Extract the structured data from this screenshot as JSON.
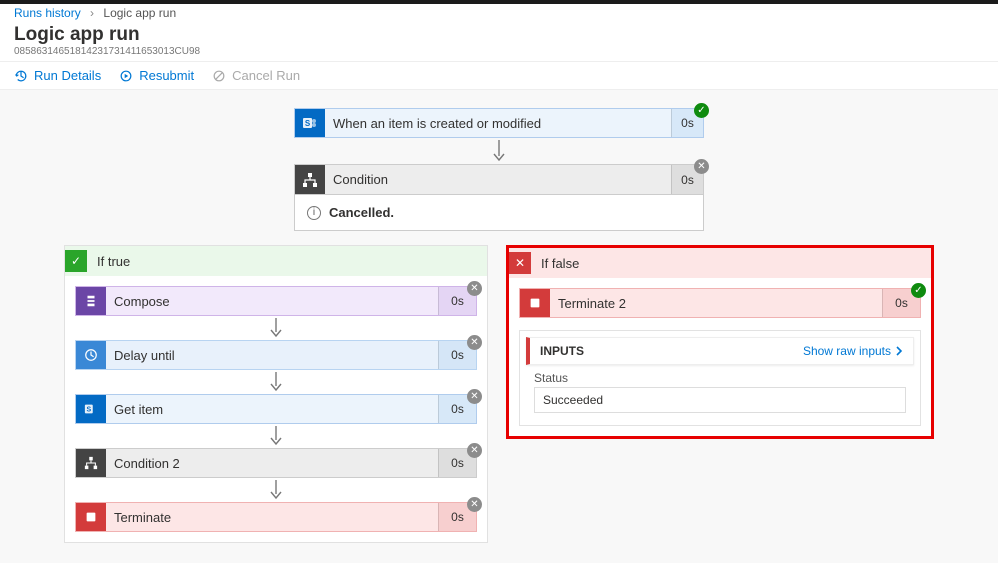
{
  "breadcrumb": {
    "root": "Runs history",
    "current": "Logic app run"
  },
  "header": {
    "title": "Logic app run",
    "run_id": "08586314651814231731411653013CU98"
  },
  "toolbar": {
    "run_details": "Run Details",
    "resubmit": "Resubmit",
    "cancel_run": "Cancel Run"
  },
  "trigger": {
    "label": "When an item is created or modified",
    "duration": "0s",
    "status": "ok"
  },
  "condition": {
    "label": "Condition",
    "duration": "0s",
    "status": "skip",
    "message": "Cancelled."
  },
  "branches": {
    "true": {
      "title": "If true",
      "steps": [
        {
          "id": "compose",
          "label": "Compose",
          "theme": "purple",
          "duration": "0s",
          "status": "skip"
        },
        {
          "id": "delay",
          "label": "Delay until",
          "theme": "lblue",
          "duration": "0s",
          "status": "skip"
        },
        {
          "id": "getitem",
          "label": "Get item",
          "theme": "blue",
          "duration": "0s",
          "status": "skip"
        },
        {
          "id": "condition2",
          "label": "Condition 2",
          "theme": "grey",
          "duration": "0s",
          "status": "skip"
        },
        {
          "id": "terminate",
          "label": "Terminate",
          "theme": "red",
          "duration": "0s",
          "status": "skip"
        }
      ]
    },
    "false": {
      "title": "If false",
      "step": {
        "label": "Terminate 2",
        "duration": "0s",
        "status": "ok"
      },
      "detail": {
        "inputs_label": "INPUTS",
        "show_raw": "Show raw inputs",
        "status_key": "Status",
        "status_value": "Succeeded"
      }
    }
  }
}
